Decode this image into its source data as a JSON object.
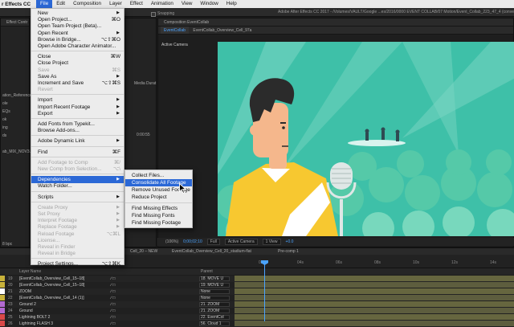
{
  "menubar": {
    "app_name": "r Effects CC",
    "items": [
      "File",
      "Edit",
      "Composition",
      "Layer",
      "Effect",
      "Animation",
      "View",
      "Window",
      "Help"
    ]
  },
  "titlebar": {
    "snapping": "Snapping",
    "title": "Adobe After Effects CC 2017 - /Volumes/VAULT/Google ...es/2016/0000 EVENT COLLAB/07 Motion/Event_Collab_223_47_4 (conve"
  },
  "left_panel": {
    "tab": "Effect Contr",
    "texts": [
      "ation_Reference",
      "ole",
      "EQs",
      "ok",
      "ing",
      "ds",
      "ab_MIX_NOV3.mp3",
      "Media Durat",
      "0:00:55",
      "8 bpc"
    ]
  },
  "comp_panel": {
    "header": "Composition EventCollab",
    "tabs": [
      "EventCollab",
      "EventCollab_Overview_Cell_97a"
    ],
    "camera_label": "Active Camera"
  },
  "viewer_toolbar": {
    "zoom": "(106%)",
    "timecode": "0;00;02;10",
    "resolution": "Full",
    "camera": "Active Camera",
    "view": "1 View",
    "exposure": "+0.0"
  },
  "timeline_tabs": [
    "Cell_20 – NEW",
    "EventCollab_Overview_Cell_20_stadium-flat",
    "Pre-comp 1"
  ],
  "timeline_header": {
    "layer_name": "Layer Name",
    "parent": "Parent"
  },
  "ruler_ticks": [
    "02s",
    "04s",
    "06s",
    "08s",
    "10s",
    "12s",
    "14s"
  ],
  "layers": [
    {
      "num": "19",
      "name": "[EventCollab_Overview_Cell_15–18]",
      "parent": "18. MOVE U",
      "color": "#c8b23a"
    },
    {
      "num": "20",
      "name": "[EventCollab_Overview_Cell_15–18]",
      "parent": "19. MOVE U",
      "color": "#c8b23a"
    },
    {
      "num": "21",
      "name": "ZOOM",
      "parent": "None",
      "color": "#ffffff"
    },
    {
      "num": "22",
      "name": "[EventCollab_Overview_Cell_14 (1)]",
      "parent": "None",
      "color": "#c8b23a"
    },
    {
      "num": "23",
      "name": "Ground 2",
      "parent": "21. ZOOM",
      "color": "#b36ad1"
    },
    {
      "num": "24",
      "name": "Ground",
      "parent": "21. ZOOM",
      "color": "#b36ad1"
    },
    {
      "num": "25",
      "name": "Lightning BOLT 2",
      "parent": "22. EventCol",
      "color": "#d94848"
    },
    {
      "num": "26",
      "name": "Lightning FLASH 3",
      "parent": "56. Cloud 1",
      "color": "#d94848"
    }
  ],
  "file_menu": {
    "items": [
      {
        "label": "New",
        "sc": "",
        "ar": true,
        "dis": false
      },
      {
        "label": "Open Project...",
        "sc": "⌘O",
        "ar": false,
        "dis": false
      },
      {
        "label": "Open Team Project (Beta)...",
        "sc": "",
        "ar": false,
        "dis": false
      },
      {
        "label": "Open Recent",
        "sc": "",
        "ar": true,
        "dis": false
      },
      {
        "label": "Browse in Bridge...",
        "sc": "⌥⇧⌘O",
        "ar": false,
        "dis": false
      },
      {
        "label": "Open Adobe Character Animator...",
        "sc": "",
        "ar": false,
        "dis": false
      },
      {
        "label": "Close",
        "sc": "⌘W",
        "ar": false,
        "dis": false
      },
      {
        "label": "Close Project",
        "sc": "",
        "ar": false,
        "dis": false
      },
      {
        "label": "Save",
        "sc": "⌘S",
        "ar": false,
        "dis": true
      },
      {
        "label": "Save As",
        "sc": "",
        "ar": true,
        "dis": false
      },
      {
        "label": "Increment and Save",
        "sc": "⌥⇧⌘S",
        "ar": false,
        "dis": false
      },
      {
        "label": "Revert",
        "sc": "",
        "ar": false,
        "dis": true
      },
      {
        "label": "Import",
        "sc": "",
        "ar": true,
        "dis": false
      },
      {
        "label": "Import Recent Footage",
        "sc": "",
        "ar": true,
        "dis": false
      },
      {
        "label": "Export",
        "sc": "",
        "ar": true,
        "dis": false
      },
      {
        "label": "Add Fonts from Typekit...",
        "sc": "",
        "ar": false,
        "dis": false
      },
      {
        "label": "Browse Add-ons...",
        "sc": "",
        "ar": false,
        "dis": false
      },
      {
        "label": "Adobe Dynamic Link",
        "sc": "",
        "ar": true,
        "dis": false
      },
      {
        "label": "Find",
        "sc": "⌘F",
        "ar": false,
        "dis": false
      },
      {
        "label": "Add Footage to Comp",
        "sc": "⌘/",
        "ar": false,
        "dis": true
      },
      {
        "label": "New Comp from Selection...",
        "sc": "⌥\\",
        "ar": false,
        "dis": true
      },
      {
        "label": "Dependencies",
        "sc": "",
        "ar": true,
        "dis": false,
        "hi": true
      },
      {
        "label": "Watch Folder...",
        "sc": "",
        "ar": false,
        "dis": false
      },
      {
        "label": "Scripts",
        "sc": "",
        "ar": true,
        "dis": false
      },
      {
        "label": "Create Proxy",
        "sc": "",
        "ar": true,
        "dis": true
      },
      {
        "label": "Set Proxy",
        "sc": "",
        "ar": true,
        "dis": true
      },
      {
        "label": "Interpret Footage",
        "sc": "",
        "ar": true,
        "dis": true
      },
      {
        "label": "Replace Footage",
        "sc": "",
        "ar": true,
        "dis": true
      },
      {
        "label": "Reload Footage",
        "sc": "⌥⌘L",
        "ar": false,
        "dis": true
      },
      {
        "label": "License...",
        "sc": "",
        "ar": false,
        "dis": true
      },
      {
        "label": "Reveal in Finder",
        "sc": "",
        "ar": false,
        "dis": true
      },
      {
        "label": "Reveal in Bridge",
        "sc": "",
        "ar": false,
        "dis": true
      },
      {
        "label": "Project Settings...",
        "sc": "⌥⇧⌘K",
        "ar": false,
        "dis": false
      }
    ]
  },
  "dependencies_submenu": {
    "items": [
      {
        "label": "Collect Files..."
      },
      {
        "label": "Consolidate All Footage",
        "hi": true
      },
      {
        "label": "Remove Unused Footage"
      },
      {
        "label": "Reduce Project"
      },
      {
        "label": "Find Missing Effects"
      },
      {
        "label": "Find Missing Fonts"
      },
      {
        "label": "Find Missing Footage"
      }
    ]
  },
  "colors": {
    "menu_highlight": "#2b68d6",
    "viewer_bg": "#3ec0a8",
    "accent_blue": "#4aa3ff"
  }
}
